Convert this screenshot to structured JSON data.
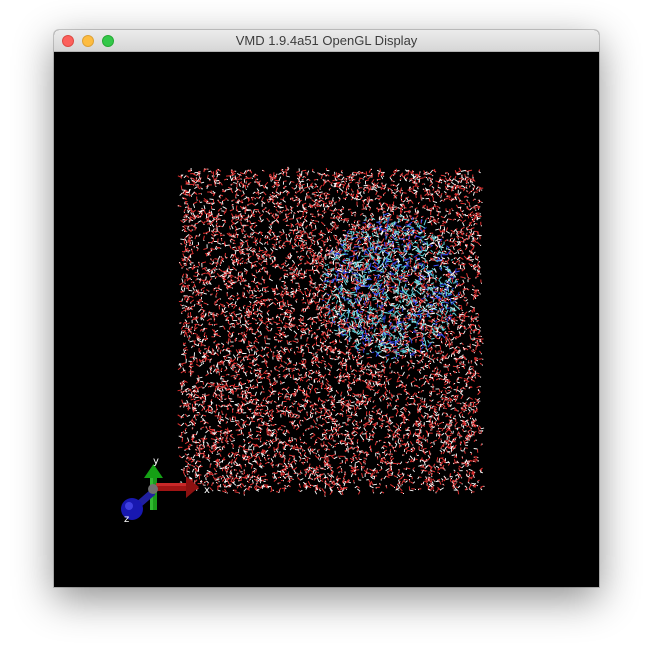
{
  "window": {
    "title": "VMD 1.9.4a51 OpenGL Display"
  },
  "axes": {
    "x_label": "x",
    "y_label": "y",
    "z_label": "z"
  },
  "colors": {
    "background": "#000000",
    "water_oxygen": "#e03030",
    "water_hydrogen": "#ffffff",
    "protein": "#5fd0d8",
    "axis_x": "#b01818",
    "axis_y": "#1a9a1a",
    "axis_z": "#1a1ab8"
  },
  "scene": {
    "representation": "lines",
    "contents": [
      "water box",
      "protein"
    ]
  }
}
